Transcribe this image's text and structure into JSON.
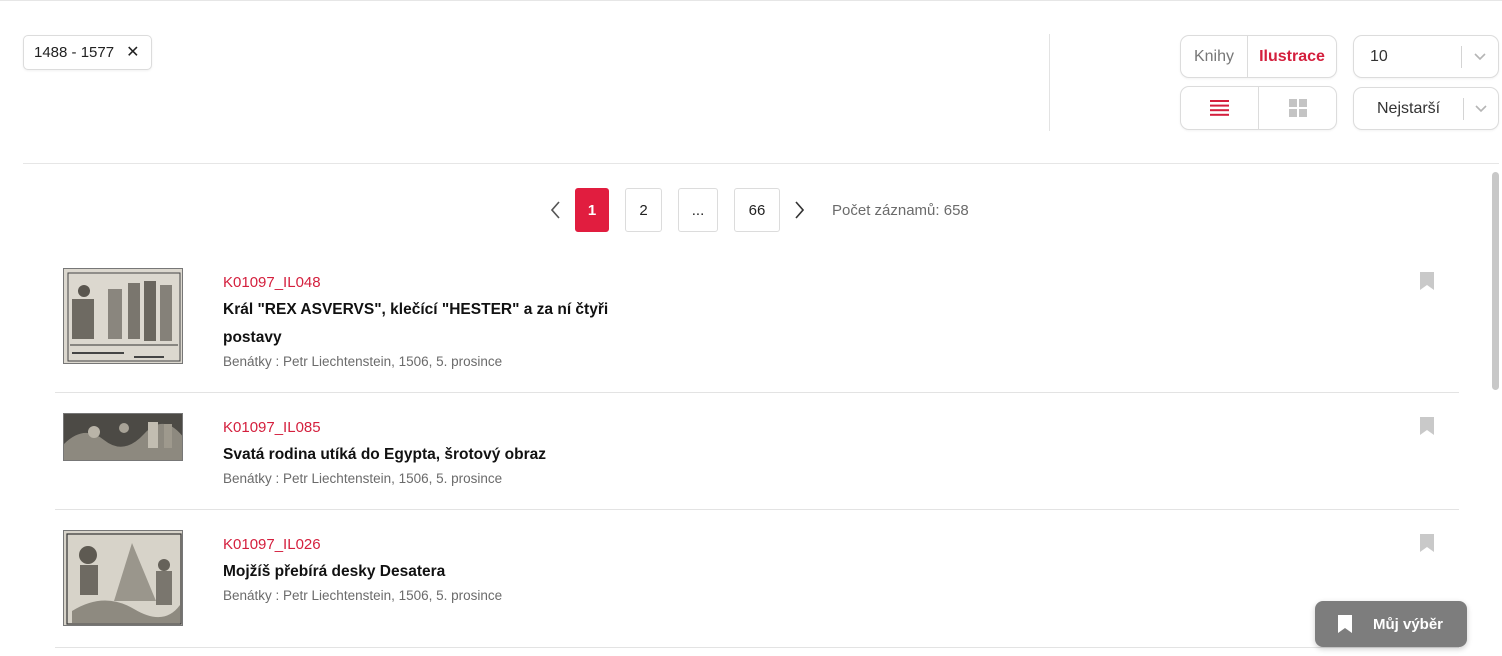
{
  "filters": {
    "year_range_chip": "1488 - 1577",
    "remove_glyph": "✕"
  },
  "toolbar": {
    "type_options": [
      {
        "label": "Knihy",
        "active": false
      },
      {
        "label": "Ilustrace",
        "active": true
      }
    ],
    "view_options": [
      {
        "icon": "list-view-icon",
        "active": true
      },
      {
        "icon": "grid-view-icon",
        "active": false
      }
    ],
    "per_page": "10",
    "sort": "Nejstarší"
  },
  "pagination": {
    "pages": [
      {
        "label": "1",
        "active": true
      },
      {
        "label": "2",
        "active": false
      },
      {
        "label": "...",
        "active": false
      },
      {
        "label": "66",
        "active": false
      }
    ],
    "record_count_text": "Počet záznamů: 658"
  },
  "results": [
    {
      "code": "K01097_IL048",
      "title": "Král \"REX ASVERVS\", klečící \"HESTER\" a za ní čtyři postavy",
      "meta": "Benátky : Petr Liechtenstein, 1506, 5. prosince"
    },
    {
      "code": "K01097_IL085",
      "title": "Svatá rodina utíká do Egypta, šrotový obraz",
      "meta": "Benátky : Petr Liechtenstein, 1506, 5. prosince"
    },
    {
      "code": "K01097_IL026",
      "title": "Mojžíš přebírá desky Desatera",
      "meta": "Benátky : Petr Liechtenstein, 1506, 5. prosince"
    }
  ],
  "my_selection_button": "Můj výběr",
  "colors": {
    "accent": "#e11d3f",
    "accent_text": "#d41f3d",
    "muted": "#6b6b6b",
    "fab": "#7d7d7d"
  }
}
